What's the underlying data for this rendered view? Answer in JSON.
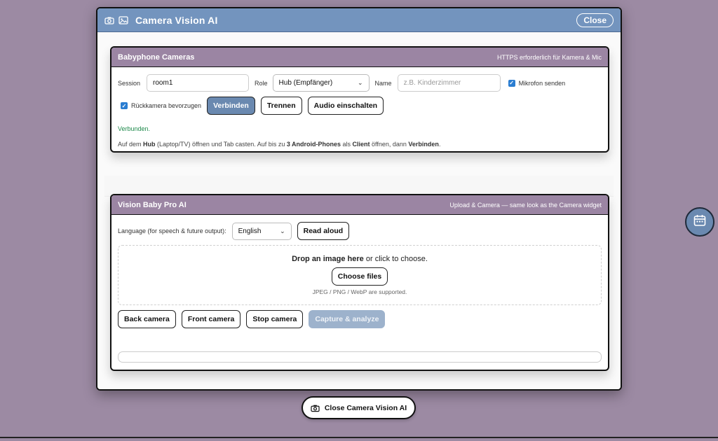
{
  "modal": {
    "title": "Camera Vision AI",
    "close_label": "Close"
  },
  "babyphone": {
    "title": "Babyphone Cameras",
    "note": "HTTPS erforderlich für Kamera & Mic",
    "session_label": "Session",
    "session_value": "room1",
    "role_label": "Role",
    "role_value": "Hub (Empfänger)",
    "name_label": "Name",
    "name_placeholder": "z.B. Kinderzimmer",
    "mic_label": "Mikrofon senden",
    "rear_cam_label": "Rückkamera bevorzugen",
    "connect_label": "Verbinden",
    "disconnect_label": "Trennen",
    "audio_label": "Audio einschalten",
    "status": "Verbunden.",
    "help": {
      "p1": "Auf dem ",
      "hub": "Hub",
      "p2": " (Laptop/TV) öffnen und Tab casten. Auf bis zu ",
      "phones": "3 Android-Phones",
      "p3": " als ",
      "client": "Client",
      "p4": " öffnen, dann ",
      "connect": "Verbinden",
      "p5": "."
    }
  },
  "vision": {
    "title": "Vision Baby Pro AI",
    "note": "Upload & Camera — same look as the Camera widget",
    "language_label": "Language (for speech & future output):",
    "language_value": "English",
    "read_aloud_label": "Read aloud",
    "drop_bold": "Drop an image here",
    "drop_rest": " or click to choose.",
    "choose_files_label": "Choose files",
    "formats": "JPEG / PNG / WebP are supported.",
    "back_camera_label": "Back camera",
    "front_camera_label": "Front camera",
    "stop_camera_label": "Stop camera",
    "capture_label": "Capture & analyze"
  },
  "bottom": {
    "close_vision_label": "Close Camera Vision AI"
  },
  "side": {
    "icon": "calendar-icon"
  }
}
